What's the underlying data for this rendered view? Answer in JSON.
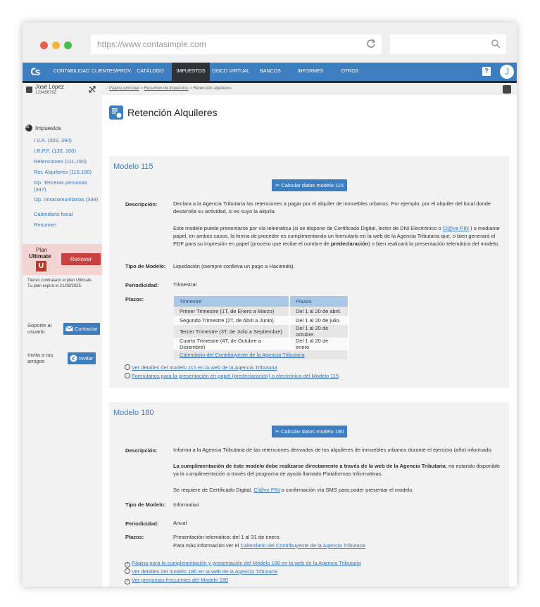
{
  "browser": {
    "url": "https://www.contasimple.com"
  },
  "nav": {
    "logo": "Cs",
    "items": [
      "CONTABILIDAD",
      "CLIENTES/PROV.",
      "CATÁLOGO",
      "IMPUESTOS",
      "DISCO VIRTUAL",
      "BANCOS",
      "INFORMES",
      "OTROS"
    ],
    "active": "IMPUESTOS",
    "help": "?",
    "avatar": "J"
  },
  "sidebar": {
    "user_name": "José López",
    "user_nif": "12345678Z",
    "section_title": "Impuestos",
    "links": [
      "I.V.A. (303, 390)",
      "I.R.P.F. (130, 100)",
      "Retenciones (111,190)",
      "Ret. Alquileres (115,180)",
      "Op. Terceras personas",
      "(347)",
      "Op. Intracomunitarias (349)",
      "Calendario fiscal",
      "Resumen"
    ],
    "plan": {
      "label": "Plan",
      "name": "Ultimate",
      "badge": "U",
      "renew": "Renovar",
      "note_1": "Tienes contratado el plan Ultimate.",
      "note_2": "Tu plan expira el 21/08/2025."
    },
    "support": {
      "text_1": "Soporte al",
      "text_2": "usuario",
      "button": "Contactar"
    },
    "invite": {
      "text_1": "Invita a tus",
      "text_2": "amigos",
      "button": "Invitar"
    }
  },
  "breadcrumb": {
    "prefix": "::",
    "home": "Página principal",
    "sep1": ">",
    "parent": "Resumen de impuestos",
    "sep2": ">",
    "current": "Retención alquileres"
  },
  "page": {
    "title": "Retención Alquileres"
  },
  "modelo115": {
    "title": "Modelo 115",
    "calc_button": "Calcular datos modelo 115",
    "desc_label": "Descripción:",
    "desc_p1": "Declara a la Agencia Tributaria las retenciones a pagar por el alquiler de inmuebles urbanos. Por ejemplo, por el alquiler del local donde desarrolla su actividad, si es suyo la alquila.",
    "desc_p2_a": "Este modelo puede presentarse por vía telemática (si se dispone de Certificado Digital, lector de DNI Electrónico o ",
    "desc_p2_link": "Cl@ve PIN",
    "desc_p2_b": " ) o mediante papel, en ambos casos, la forma de proceder es cumplimentando un formulario en la web de la Agencia Tributaria que, o bien generará el PDF para su impresión en papel (proceso que recibe el nombre de ",
    "desc_p2_bold": "predeclaración",
    "desc_p2_c": ") o bien realizará la presentación telemática del modelo.",
    "tipo_label": "Tipo de Modelo:",
    "tipo": "Liquidación (siempre conlleva un pago a Hacienda).",
    "period_label": "Periodicidad:",
    "period": "Trimestral",
    "plazos_label": "Plazos:",
    "table_headers": [
      "Trimestre",
      "Plazos"
    ],
    "rows": [
      [
        "Primer Trimestre (1T, de Enero a Marzo)",
        "Del 1 al 20 de abril."
      ],
      [
        "Segundo Trimestre (2T, de Abril a Junio)",
        "Del 1 al 20 de julio."
      ],
      [
        "Tercer Trimestre (3T, de Julio a Septiembre)",
        "Del 1 al 20 de octubre."
      ],
      [
        "Cuarto Trimestre (4T, de Octubre a Diciembre)",
        "Del 1 al 20 de enero"
      ]
    ],
    "calendar_link": "Calendario del Contribuyente de la Agencia Tributaria",
    "link_1": "Ver detalles del modelo 115 en la web de la Agencia Tributaria",
    "link_2": "Formularios para la presentación en papel (predeclaración) o electrónica del Modelo 115"
  },
  "modelo180": {
    "title": "Modelo 180",
    "calc_button": "Calcular datos modelo 180",
    "desc_label": "Descripción:",
    "desc_p1": "Informa a la Agencia Tributaria de las retenciones derivadas de los alquileres de inmuebles urbanos durante el ejercicio (año) informado.",
    "desc_p2_bold": "La cumplimentación de éste modelo debe realizarse directamente a través de la web de la Agencia Tributaria",
    "desc_p2_rest": ", no estando disponible ya la cumplimentación a través del programa de ayuda llamado Plataformas Informativas.",
    "desc_p3_a": "Se requiere de Certificado Digital, ",
    "desc_p3_link": "Cl@ve PIN",
    "desc_p3_b": " o confirmación vía SMS para poder presentar el modelo.",
    "tipo_label": "Tipo de Modelo:",
    "tipo": "Informativo",
    "period_label": "Periodicidad:",
    "period": "Anual",
    "plazos_label": "Plazos:",
    "plazos_1": "Presentación telemática: del 1 al 31 de enero.",
    "plazos_2_a": "Para más información ver el ",
    "plazos_2_link": "Calendario del Contribuyente de la Agencia Tributaria",
    "link_1": "Página para la cumplimentación y presentación del Modelo 180 en la web de la Agencia Tributaria",
    "link_2": "Ver detalles del modelo 180 en la web de la Agencia Tributaria",
    "link_3": "Ver preguntas frecuentes del Modelo 180"
  },
  "colors": {
    "accent": "#3c7ec0",
    "renew": "#c94040",
    "plan_bg": "#f4d3d3"
  }
}
